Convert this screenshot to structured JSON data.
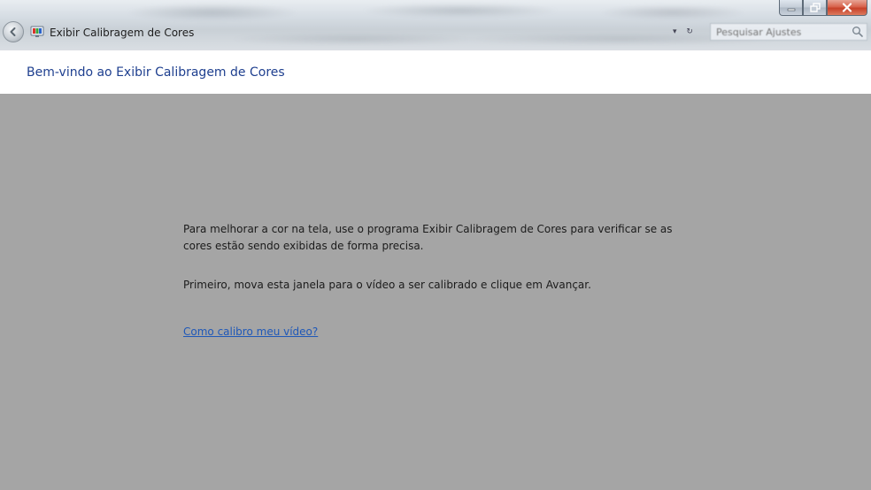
{
  "window": {
    "title": "Exibir Calibragem de Cores",
    "search_placeholder": "Pesquisar Ajustes",
    "icons": {
      "back": "back-arrow-icon",
      "app": "color-calibration-icon",
      "search": "search-icon",
      "minimize": "minimize-icon",
      "maximize": "restore-icon",
      "close": "close-icon"
    },
    "colors": {
      "close_button": "#c7412a",
      "background": "#a5a5a5",
      "header_title": "#1e3f8f",
      "link": "#1f58b8"
    }
  },
  "header": {
    "title": "Bem-vindo ao Exibir Calibragem de Cores"
  },
  "content": {
    "paragraph1": "Para melhorar a cor na tela, use o programa Exibir Calibragem de Cores para verificar se as cores estão sendo exibidas de forma precisa.",
    "paragraph2": "Primeiro, mova esta janela para o vídeo a ser calibrado e clique em Avançar.",
    "help_link": "Como calibro meu vídeo?"
  }
}
